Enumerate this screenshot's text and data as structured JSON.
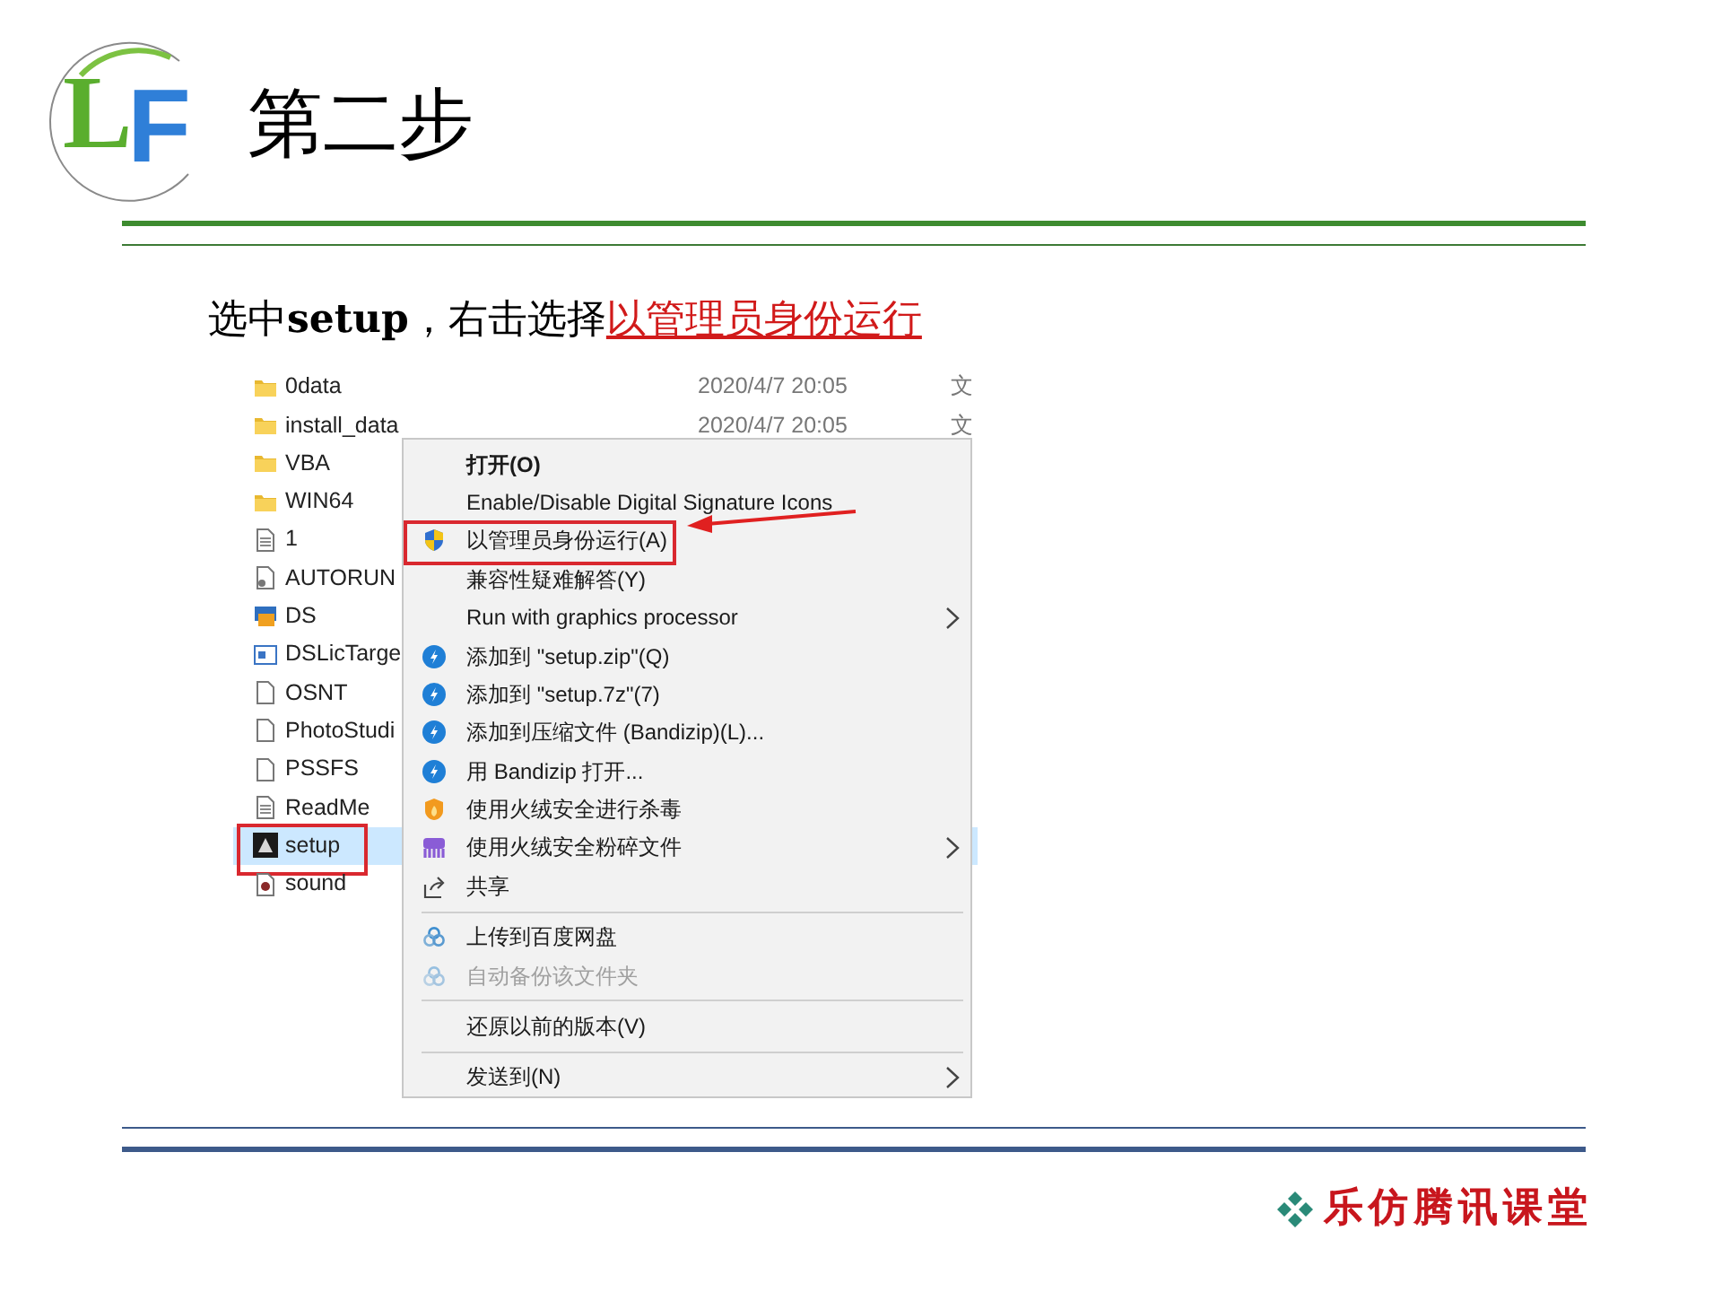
{
  "logo": {
    "letters": [
      "L",
      "F"
    ]
  },
  "title": "第二步",
  "instruction": {
    "text": "选中**setup**，右击选择",
    "highlight": "以管理员身份运行"
  },
  "files": [
    {
      "kind": "folder",
      "name": "0data",
      "date": "2020/4/7 20:05",
      "type": "文",
      "selected": false
    },
    {
      "kind": "folder",
      "name": "install_data",
      "date": "2020/4/7 20:05",
      "type": "文",
      "selected": false
    },
    {
      "kind": "folder",
      "name": "VBA",
      "selected": false
    },
    {
      "kind": "folder",
      "name": "WIN64",
      "selected": false
    },
    {
      "kind": "text",
      "name": "1",
      "selected": false
    },
    {
      "kind": "autorun",
      "name": "AUTORUN",
      "selected": false
    },
    {
      "kind": "app",
      "name": "DS",
      "selected": false
    },
    {
      "kind": "window",
      "name": "DSLicTarge",
      "selected": false
    },
    {
      "kind": "blank",
      "name": "OSNT",
      "selected": false
    },
    {
      "kind": "blank",
      "name": "PhotoStudi",
      "selected": false
    },
    {
      "kind": "blank",
      "name": "PSSFS",
      "selected": false
    },
    {
      "kind": "text",
      "name": "ReadMe",
      "selected": false
    },
    {
      "kind": "setup",
      "name": "setup",
      "selected": true
    },
    {
      "kind": "media",
      "name": "sound",
      "selected": false
    }
  ],
  "context_menu": {
    "items": [
      {
        "kind": "item",
        "label": "打开(O)",
        "bold": true,
        "submenu": false,
        "disabled": false,
        "annotated": false
      },
      {
        "kind": "item",
        "label": "Enable/Disable Digital Signature Icons",
        "bold": false,
        "submenu": false,
        "disabled": false,
        "annotated": false
      },
      {
        "kind": "shield",
        "label": "以管理员身份运行(A)",
        "bold": false,
        "submenu": false,
        "disabled": false,
        "annotated": true
      },
      {
        "kind": "item",
        "label": "兼容性疑难解答(Y)",
        "bold": false,
        "submenu": false,
        "disabled": false,
        "annotated": false
      },
      {
        "kind": "item",
        "label": "Run with graphics processor",
        "bold": false,
        "submenu": true,
        "disabled": false,
        "annotated": false
      },
      {
        "kind": "archive",
        "label": "添加到 \"setup.zip\"(Q)",
        "bold": false,
        "submenu": false,
        "disabled": false,
        "annotated": false
      },
      {
        "kind": "archive",
        "label": "添加到 \"setup.7z\"(7)",
        "bold": false,
        "submenu": false,
        "disabled": false,
        "annotated": false
      },
      {
        "kind": "archive",
        "label": "添加到压缩文件 (Bandizip)(L)...",
        "bold": false,
        "submenu": false,
        "disabled": false,
        "annotated": false
      },
      {
        "kind": "archive",
        "label": "用 Bandizip 打开...",
        "bold": false,
        "submenu": false,
        "disabled": false,
        "annotated": false
      },
      {
        "kind": "antivirus",
        "label": "使用火绒安全进行杀毒",
        "bold": false,
        "submenu": false,
        "disabled": false,
        "annotated": false
      },
      {
        "kind": "shredder",
        "label": "使用火绒安全粉碎文件",
        "bold": false,
        "submenu": true,
        "disabled": false,
        "annotated": false
      },
      {
        "kind": "share",
        "label": "共享",
        "bold": false,
        "submenu": false,
        "disabled": false,
        "annotated": false
      },
      {
        "kind": "separator"
      },
      {
        "kind": "cloud",
        "label": "上传到百度网盘",
        "bold": false,
        "submenu": false,
        "disabled": false,
        "annotated": false
      },
      {
        "kind": "cloud",
        "label": "自动备份该文件夹",
        "bold": false,
        "submenu": false,
        "disabled": true,
        "annotated": false
      },
      {
        "kind": "separator"
      },
      {
        "kind": "item",
        "label": "还原以前的版本(V)",
        "bold": false,
        "submenu": false,
        "disabled": false,
        "annotated": false
      },
      {
        "kind": "separator"
      },
      {
        "kind": "item",
        "label": "发送到(N)",
        "bold": false,
        "submenu": true,
        "disabled": false,
        "annotated": false
      }
    ]
  },
  "footer": {
    "brand": "乐仿腾讯课堂"
  }
}
